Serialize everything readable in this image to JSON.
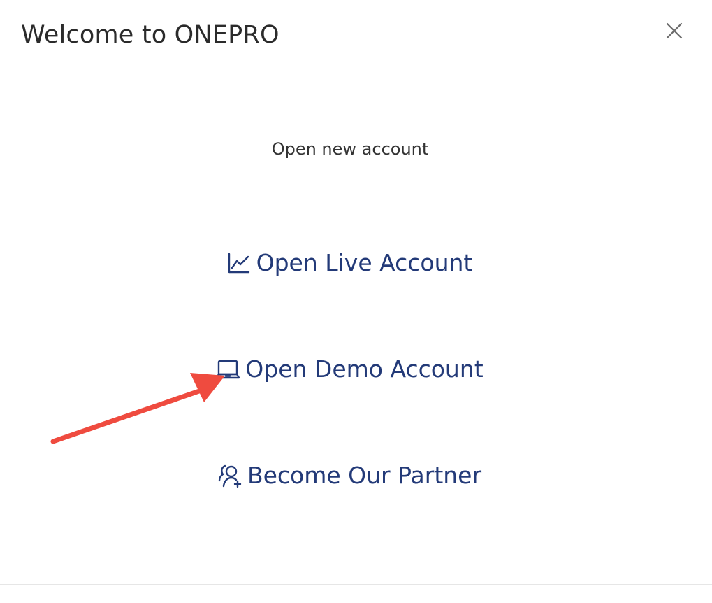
{
  "modal": {
    "title": "Welcome to ONEPRO",
    "close_icon": "close-icon",
    "subtitle": "Open new account"
  },
  "options": [
    {
      "label": "Open Live Account",
      "icon": "line-chart-icon"
    },
    {
      "label": "Open Demo Account",
      "icon": "laptop-icon"
    },
    {
      "label": "Become Our Partner",
      "icon": "add-user-icon"
    }
  ],
  "colors": {
    "link": "#233a78",
    "title": "#2b2b2b",
    "divider": "#e6e6e6",
    "annotation_arrow": "#ef4b3f"
  }
}
